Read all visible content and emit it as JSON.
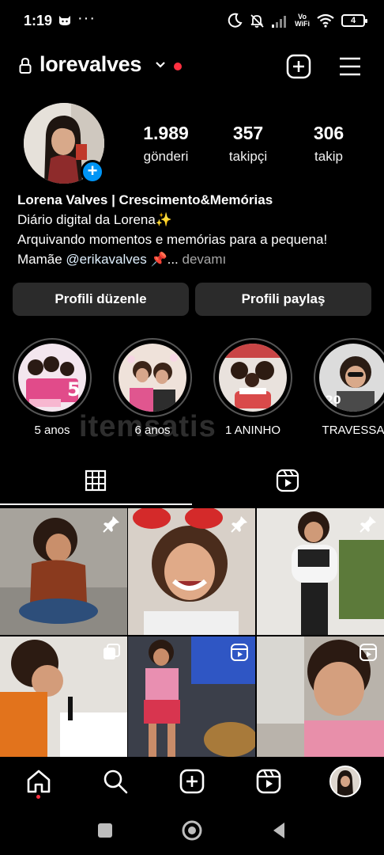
{
  "status_bar": {
    "time": "1:19",
    "dots": "···",
    "vowifi_top": "Vo",
    "vowifi_bottom": "WiFi",
    "battery": "4"
  },
  "header": {
    "username": "lorevalves"
  },
  "stats": [
    {
      "value": "1.989",
      "label": "gönderi"
    },
    {
      "value": "357",
      "label": "takipçi"
    },
    {
      "value": "306",
      "label": "takip"
    }
  ],
  "bio": {
    "name": "Lorena Valves | Crescimento&Memórias",
    "line1": "Diário digital da Lorena✨",
    "line2": "Arquivando momentos e memórias para a pequena!",
    "line3_prefix": "Mamãe ",
    "mention": "@erikavalves",
    "line3_suffix": " 📌...",
    "more": " devamı"
  },
  "buttons": {
    "edit": "Profili düzenle",
    "share": "Profili paylaş"
  },
  "highlights": [
    {
      "label": "5 anos"
    },
    {
      "label": "6 anos"
    },
    {
      "label": "1 ANINHO"
    },
    {
      "label": "TRAVESSA"
    }
  ],
  "watermark": "itemsatis",
  "icons": {
    "lock": "lock-icon",
    "chevron": "chevron-down-icon",
    "add": "add-post-icon",
    "menu": "hamburger-menu-icon",
    "grid": "grid-icon",
    "reels": "reels-icon",
    "pin": "pin-icon",
    "carousel": "carousel-icon",
    "home": "home-icon",
    "search": "search-icon",
    "create": "create-icon"
  },
  "colors": {
    "accent_blue": "#0095f6",
    "notification_red": "#ff3040",
    "button_bg": "#2b2b2b"
  }
}
